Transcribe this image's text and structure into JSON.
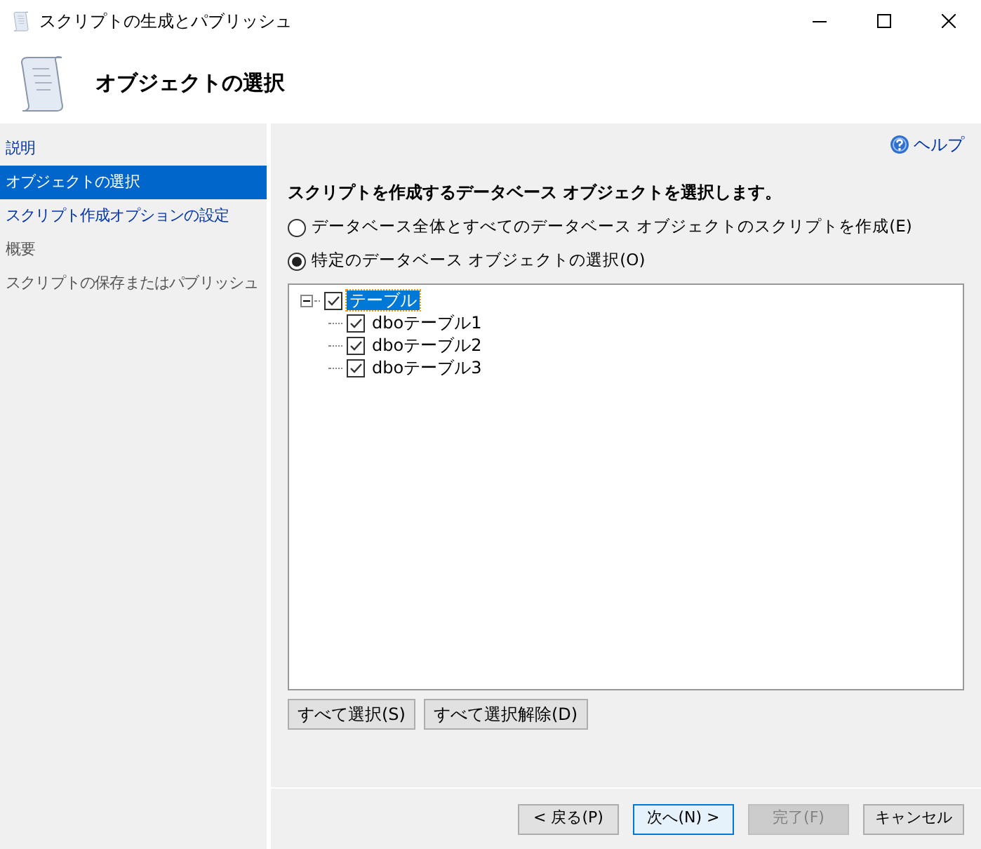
{
  "window": {
    "title": "スクリプトの生成とパブリッシュ"
  },
  "header": {
    "title": "オブジェクトの選択"
  },
  "sidebar": {
    "items": [
      {
        "label": "説明",
        "selected": false,
        "disabled": false
      },
      {
        "label": "オブジェクトの選択",
        "selected": true,
        "disabled": false
      },
      {
        "label": "スクリプト作成オプションの設定",
        "selected": false,
        "disabled": false
      },
      {
        "label": "概要",
        "selected": false,
        "disabled": true
      },
      {
        "label": "スクリプトの保存またはパブリッシュ",
        "selected": false,
        "disabled": true
      }
    ]
  },
  "help": "ヘルプ",
  "instruction": "スクリプトを作成するデータベース オブジェクトを選択します。",
  "options": [
    {
      "label": "データベース全体とすべてのデータベース オブジェクトのスクリプトを作成(E)",
      "selected": false
    },
    {
      "label": "特定のデータベース オブジェクトの選択(O)",
      "selected": true
    }
  ],
  "tree": [
    {
      "label": "テーブル",
      "checked": true,
      "selected": true,
      "expanded": true,
      "children": [
        {
          "label": "dboテーブル1",
          "checked": true,
          "selected": false
        },
        {
          "label": "dboテーブル2",
          "checked": true,
          "selected": false
        },
        {
          "label": "dboテーブル3",
          "checked": true,
          "selected": false
        }
      ]
    }
  ],
  "tree_buttons": [
    "すべて選択(S)",
    "すべて選択解除(D)"
  ],
  "footer_buttons": [
    {
      "label": "< 戻る(P)",
      "disabled": false,
      "default": false
    },
    {
      "label": "次へ(N) >",
      "disabled": false,
      "default": true
    },
    {
      "label": "完了(F)",
      "disabled": true,
      "default": false
    },
    {
      "label": "キャンセル",
      "disabled": false,
      "default": false
    }
  ]
}
